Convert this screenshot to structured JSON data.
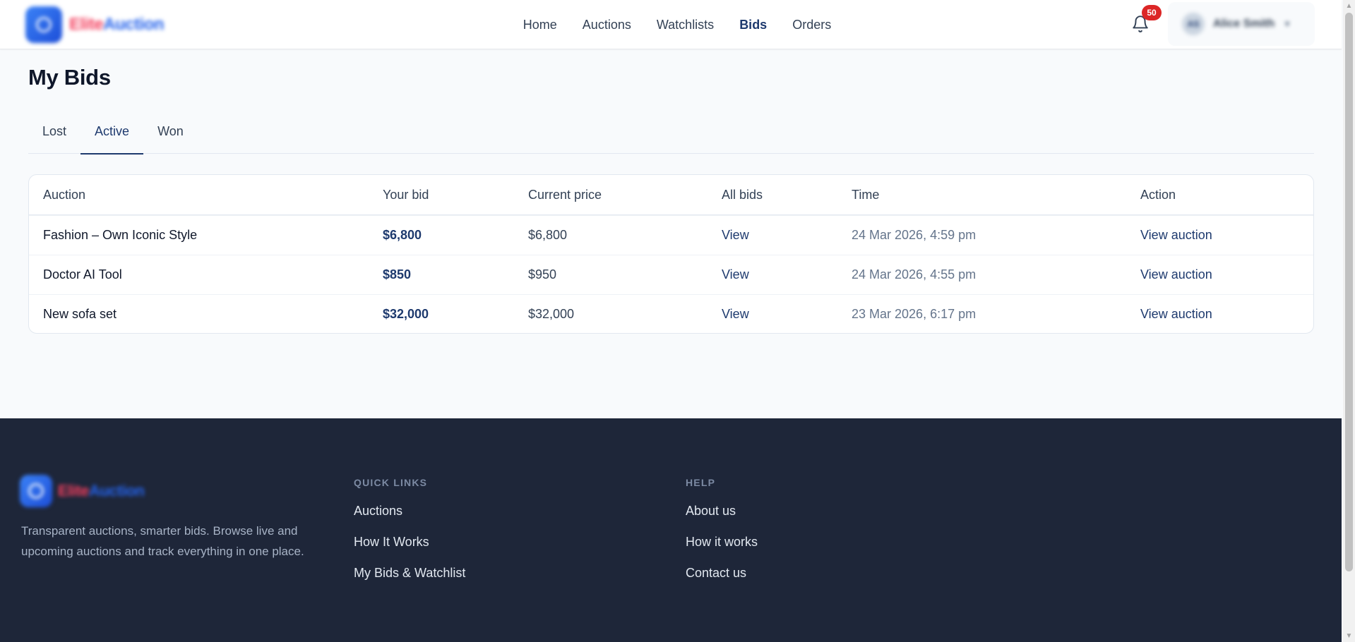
{
  "header": {
    "brand": {
      "part1": "Elite",
      "part2": "Auction"
    },
    "nav": [
      {
        "label": "Home",
        "active": false
      },
      {
        "label": "Auctions",
        "active": false
      },
      {
        "label": "Watchlists",
        "active": false
      },
      {
        "label": "Bids",
        "active": true
      },
      {
        "label": "Orders",
        "active": false
      }
    ],
    "notifications": {
      "icon": "bell-icon",
      "count": "50"
    },
    "user": {
      "initials": "AS",
      "name": "Alice Smith",
      "icon": "chevron-down-icon"
    }
  },
  "main": {
    "title": "My Bids",
    "tabs": [
      {
        "label": "Lost",
        "active": false
      },
      {
        "label": "Active",
        "active": true
      },
      {
        "label": "Won",
        "active": false
      }
    ],
    "table": {
      "columns": [
        "Auction",
        "Your bid",
        "Current price",
        "All bids",
        "Time",
        "Action"
      ],
      "rows": [
        {
          "auction": "Fashion – Own Iconic Style",
          "your_bid": "$6,800",
          "current_price": "$6,800",
          "all_bids": "View",
          "time": "24 Mar 2026, 4:59 pm",
          "action": "View auction"
        },
        {
          "auction": "Doctor AI Tool",
          "your_bid": "$850",
          "current_price": "$950",
          "all_bids": "View",
          "time": "24 Mar 2026, 4:55 pm",
          "action": "View auction"
        },
        {
          "auction": "New sofa set",
          "your_bid": "$32,000",
          "current_price": "$32,000",
          "all_bids": "View",
          "time": "23 Mar 2026, 6:17 pm",
          "action": "View auction"
        }
      ]
    }
  },
  "footer": {
    "brand": {
      "part1": "Elite",
      "part2": "Auction"
    },
    "description": "Transparent auctions, smarter bids. Browse live and upcoming auctions and track everything in one place.",
    "quick_links": {
      "heading": "QUICK LINKS",
      "items": [
        "Auctions",
        "How It Works",
        "My Bids & Watchlist"
      ]
    },
    "help": {
      "heading": "HELP",
      "items": [
        "About us",
        "How it works",
        "Contact us"
      ]
    }
  },
  "colors": {
    "primary": "#1e3a6e",
    "badge": "#dc2626",
    "footer_bg": "#1e2639",
    "page_bg": "#f8fafc"
  }
}
